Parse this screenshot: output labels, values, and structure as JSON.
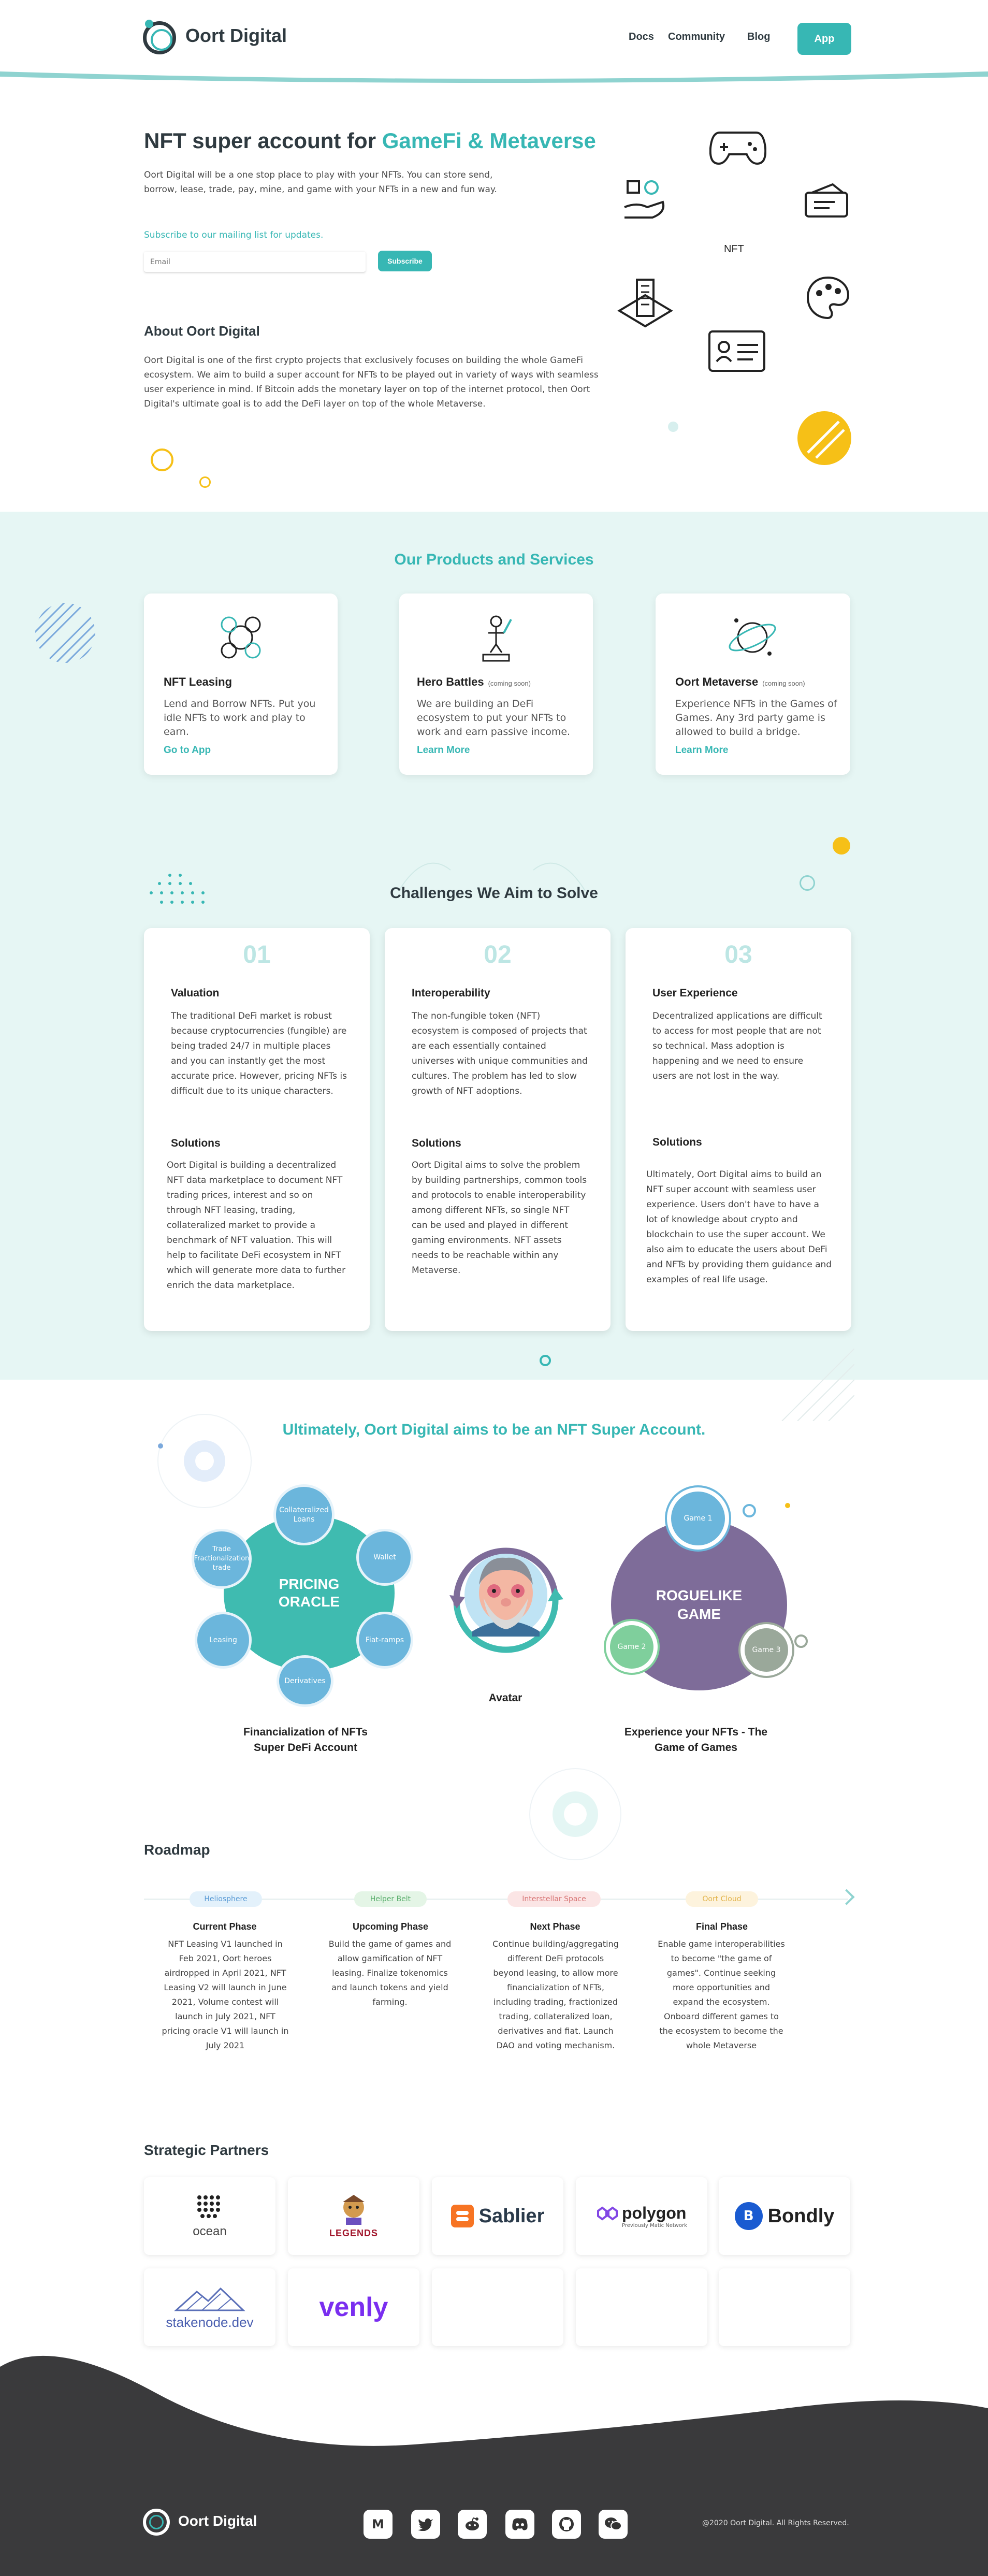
{
  "header": {
    "brand": "Oort Digital",
    "nav": [
      "Docs",
      "Community",
      "Blog"
    ],
    "app_button": "App"
  },
  "hero": {
    "title_plain": "NFT super account for ",
    "title_accent": "GameFi & Metaverse",
    "description": "Oort Digital will be a one stop place to play with your NFTs. You can store send, borrow, lease, trade, pay, mine, and game with your NFTs in a new and fun way.",
    "mailing_text": "Subscribe to our mailing list for updates.",
    "email_placeholder": "Email",
    "subscribe_button": "Subscribe",
    "nft_label": "NFT"
  },
  "about": {
    "title": "About Oort Digital",
    "text": "Oort Digital is one of the first crypto projects that exclusively focuses on building the whole GameFi ecosystem. We aim to build a super account for NFTs to be played out in variety of ways with seamless user experience in mind. If Bitcoin adds the monetary layer on top of the internet protocol, then Oort Digital's ultimate goal is to add the DeFi layer on top of the whole Metaverse."
  },
  "products": {
    "title": "Our Products and Services",
    "items": [
      {
        "title": "NFT Leasing",
        "badge": "",
        "desc": "Lend and Borrow NFTs. Put you idle NFTs to work and play to earn.",
        "link": "Go to App"
      },
      {
        "title": "Hero Battles",
        "badge": "(coming soon)",
        "desc": "We are building an DeFi ecosystem to put your NFTs to work and earn passive income.",
        "link": "Learn More"
      },
      {
        "title": "Oort Metaverse",
        "badge": "(coming soon)",
        "desc": "Experience NFTs in the Games of Games. Any 3rd party game is allowed to build a bridge.",
        "link": "Learn More"
      }
    ]
  },
  "challenges": {
    "title": "Challenges We Aim to Solve",
    "solutions_label": "Solutions",
    "items": [
      {
        "num": "01",
        "title": "Valuation",
        "text": "The traditional DeFi market is robust because cryptocurrencies (fungible) are being traded 24/7 in multiple places and you can instantly get the most accurate price. However, pricing NFTs is difficult due to its unique characters.",
        "solution": "Oort Digital is building a decentralized NFT data marketplace to document NFT trading prices, interest and so on through NFT leasing, trading, collateralized market to provide a benchmark of NFT valuation. This will help to facilitate DeFi ecosystem in NFT which will generate more data to further enrich the data marketplace."
      },
      {
        "num": "02",
        "title": "Interoperability",
        "text": "The non-fungible token (NFT) ecosystem is composed of projects that are each essentially contained universes with unique communities and cultures. The problem has led to slow growth of NFT adoptions.",
        "solution": "Oort Digital aims to solve the problem by building partnerships, common tools and protocols to enable interoperability among different NFTs, so single NFT can be used and played in different gaming environments. NFT assets needs to be reachable within any Metaverse."
      },
      {
        "num": "03",
        "title": "User Experience",
        "text": "Decentralized applications are difficult to access for most people that are not so technical. Mass adoption is happening and we need to ensure users are not lost in the way.",
        "solution": "Ultimately, Oort Digital aims to build an NFT super account with seamless user experience. Users don't have to have a lot of knowledge about crypto and blockchain to use the super account. We also aim to educate the users about DeFi and NFTs by providing them guidance and examples of real life usage."
      }
    ]
  },
  "super_account": {
    "title": "Ultimately, Oort Digital aims to be an NFT Super Account.",
    "oracle_center": "PRICING ORACLE",
    "oracle_nodes": [
      "Collateralized Loans",
      "Wallet",
      "Fiat-ramps",
      "Derivatives",
      "Leasing",
      "Trade Fractionalization trade"
    ],
    "oracle_caption": "Financialization of NFTs Super DeFi Account",
    "avatar_caption": "Avatar",
    "game_center": "ROGUELIKE GAME",
    "game_nodes": [
      "Game 1",
      "Game 2",
      "Game 3"
    ],
    "game_caption": "Experience your NFTs - The Game of Games"
  },
  "roadmap": {
    "title": "Roadmap",
    "phases": [
      {
        "pill": "Heliosphere",
        "title": "Current Phase",
        "text": "NFT Leasing V1 launched in Feb 2021, Oort heroes airdropped in April 2021, NFT Leasing V2 will launch in June 2021, Volume contest will launch in July 2021, NFT pricing oracle V1 will launch in July 2021"
      },
      {
        "pill": "Helper Belt",
        "title": "Upcoming Phase",
        "text": "Build the game of games and allow gamification of NFT leasing. Finalize tokenomics and launch tokens and yield farming."
      },
      {
        "pill": "Interstellar Space",
        "title": "Next Phase",
        "text": "Continue building/aggregating different DeFi protocols beyond leasing, to allow more financialization of NFTs, including trading, fractionized trading, collateralized loan, derivatives and fiat. Launch DAO and voting mechanism."
      },
      {
        "pill": "Oort Cloud",
        "title": "Final Phase",
        "text": "Enable game interoperabilities to become \"the game of games\". Continue seeking more opportunities and expand the ecosystem. Onboard different games to the ecosystem to become the whole Metaverse"
      }
    ]
  },
  "partners": {
    "title": "Strategic Partners",
    "logos": [
      "ocean",
      "LEGENDS",
      "Sablier",
      "polygon",
      "Previously Matic Network",
      "Bondly",
      "stakenode.dev",
      "venly"
    ]
  },
  "footer": {
    "brand": "Oort Digital",
    "copyright": "@2020 Oort Digital. All Rights Reserved.",
    "social_icons": [
      "medium-icon",
      "twitter-icon",
      "reddit-icon",
      "discord-icon",
      "github-icon",
      "wechat-icon"
    ]
  },
  "colors": {
    "accent": "#37b7b4",
    "dark": "#2f3a40",
    "mint_bg": "#e6f6f4",
    "footer_bg": "#3a3a3c",
    "yellow": "#f6c017",
    "purple": "#7e6c99"
  }
}
